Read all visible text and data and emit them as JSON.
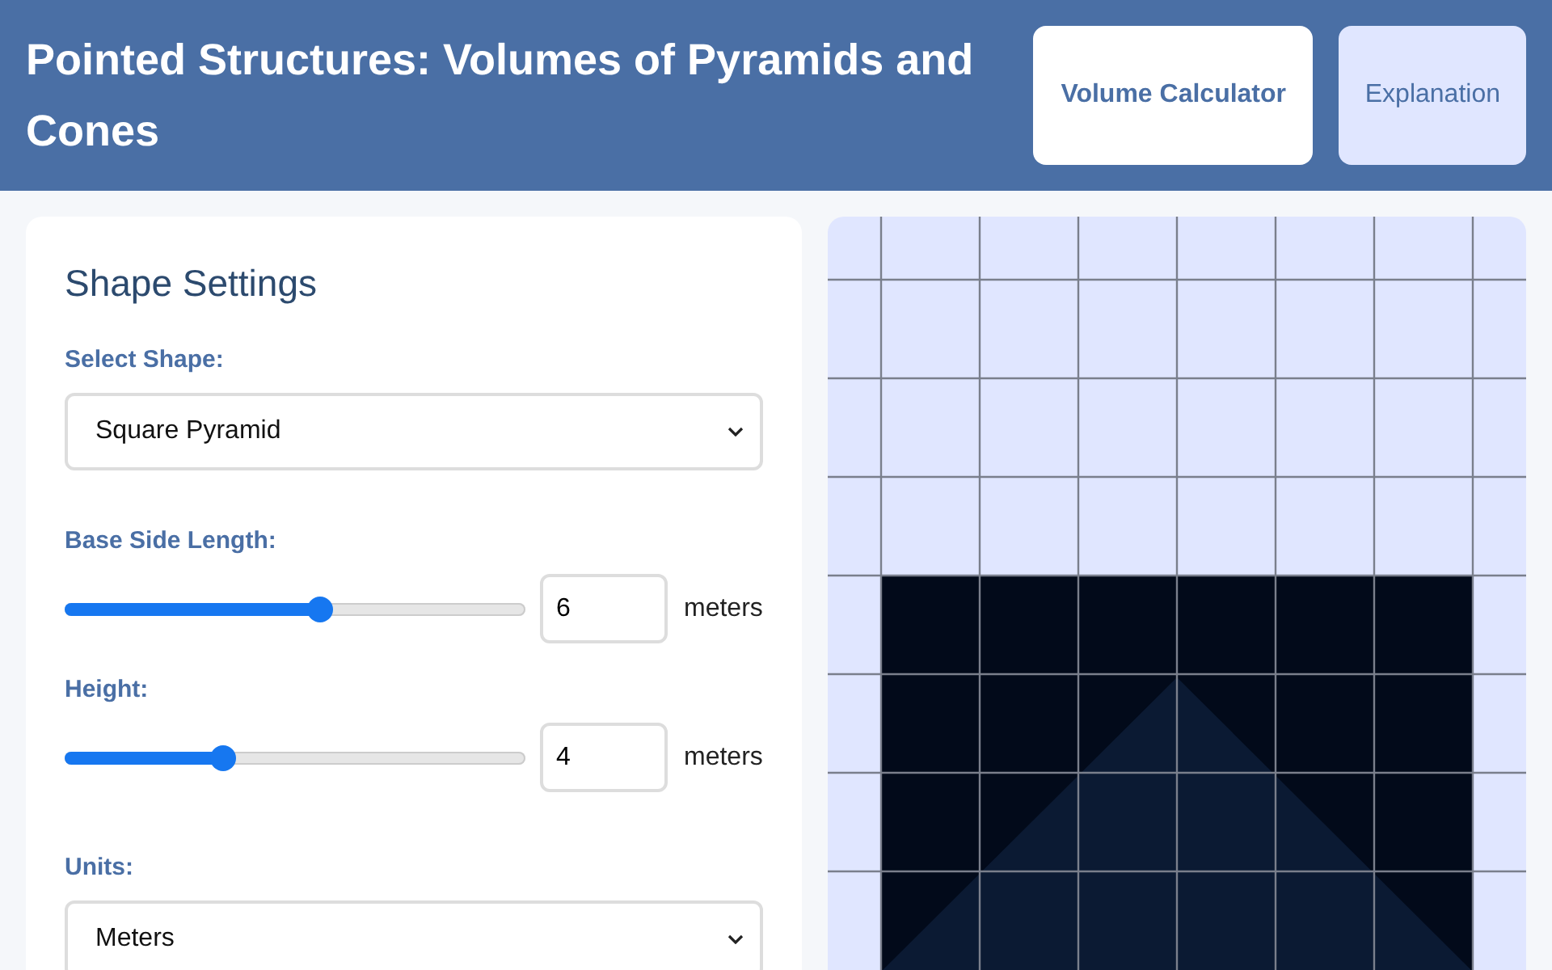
{
  "header": {
    "title": "Pointed Structures: Volumes of Pyramids and Cones",
    "tabs": [
      {
        "label": "Volume Calculator",
        "selected": true
      },
      {
        "label": "Explanation",
        "selected": false
      }
    ]
  },
  "settings": {
    "title": "Shape Settings",
    "fields": [
      {
        "kind": "select",
        "label": "Select Shape:",
        "value": "Square Pyramid"
      },
      {
        "kind": "slider",
        "label": "Base Side Length:",
        "level": 0.555,
        "value": "6",
        "unit": "meters"
      },
      {
        "kind": "slider",
        "label": "Height:",
        "level": 0.344,
        "value": "4",
        "unit": "meters"
      },
      {
        "kind": "select",
        "label": "Units:",
        "value": "Meters"
      }
    ]
  }
}
